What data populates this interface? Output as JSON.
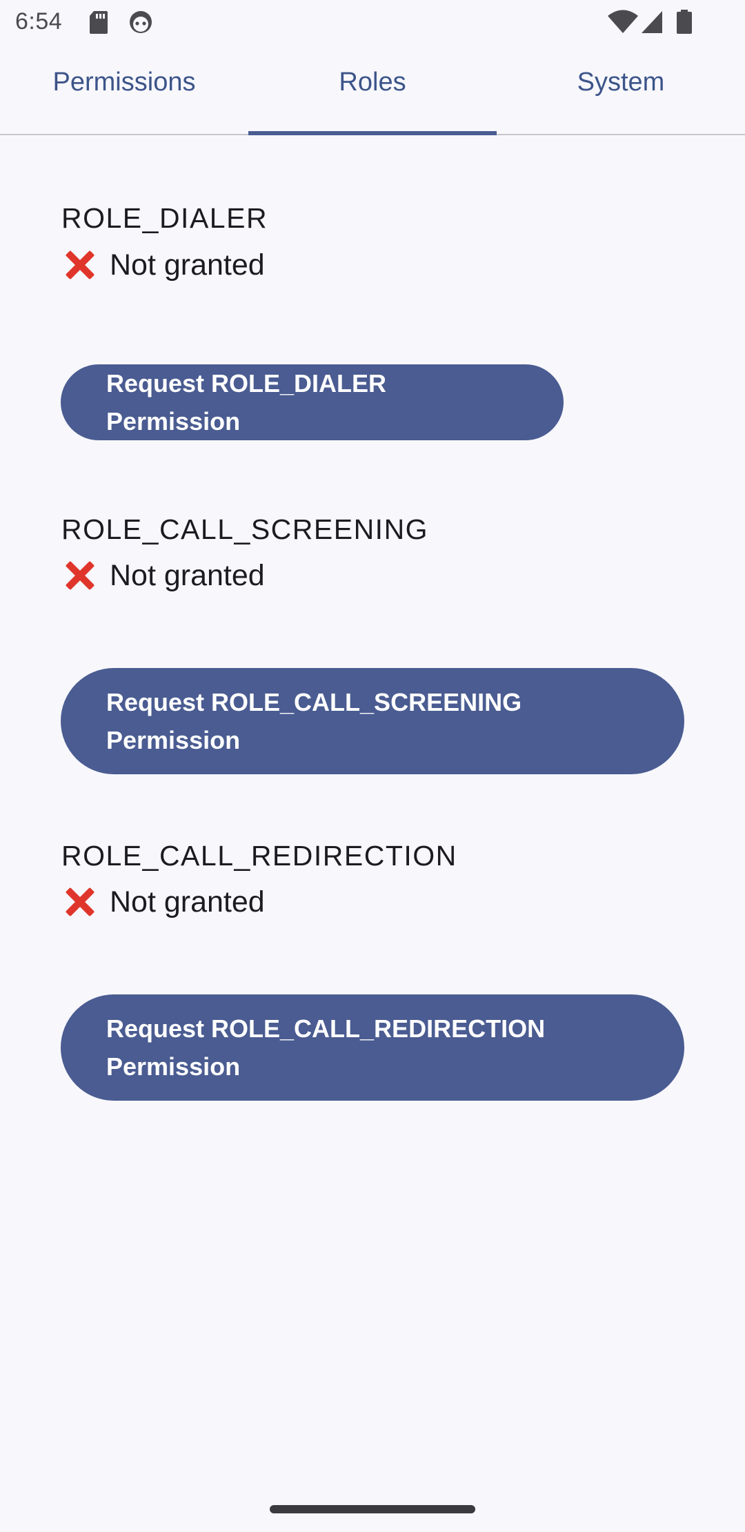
{
  "status_bar": {
    "time": "6:54",
    "icons": [
      "sd-card-icon",
      "android-face-icon",
      "wifi-icon",
      "cell-signal-icon",
      "battery-icon"
    ]
  },
  "tabs": [
    {
      "label": "Permissions",
      "selected": false
    },
    {
      "label": "Roles",
      "selected": true
    },
    {
      "label": "System",
      "selected": false
    }
  ],
  "roles": [
    {
      "name": "ROLE_DIALER",
      "status": "Not granted",
      "button_label": "Request ROLE_DIALER Permission"
    },
    {
      "name": "ROLE_CALL_SCREENING",
      "status": "Not granted",
      "button_label": "Request ROLE_CALL_SCREENING Permission"
    },
    {
      "name": "ROLE_CALL_REDIRECTION",
      "status": "Not granted",
      "button_label": "Request ROLE_CALL_REDIRECTION Permission"
    }
  ],
  "colors": {
    "accent": "#4a5c91",
    "tab_text": "#3c5489",
    "status_icon": "#e0352b",
    "background": "#f7f7fc"
  }
}
